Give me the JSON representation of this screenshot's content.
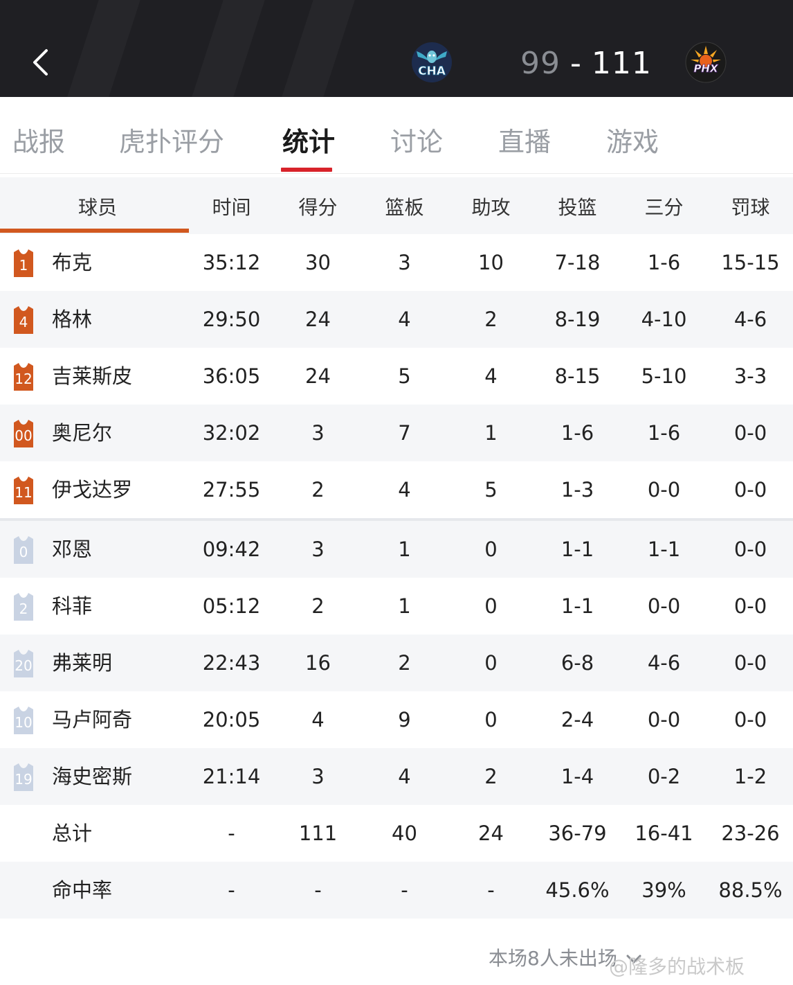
{
  "header": {
    "away_team": "CHA",
    "home_team": "PHX",
    "away_score": "99",
    "score_separator": "-",
    "home_score": "111",
    "back_icon": "chevron-left-icon",
    "colors": {
      "bg": "#1f1f23",
      "away_score": "#8a8d93",
      "home_score": "#ffffff"
    }
  },
  "tabs": [
    {
      "label": "战报"
    },
    {
      "label": "虎扑评分"
    },
    {
      "label": "统计",
      "active": true
    },
    {
      "label": "讨论"
    },
    {
      "label": "直播"
    },
    {
      "label": "游戏"
    }
  ],
  "table": {
    "columns": [
      "球员",
      "时间",
      "得分",
      "篮板",
      "助攻",
      "投篮",
      "三分",
      "罚球"
    ],
    "starters": [
      {
        "number": "1",
        "name": "布克",
        "min": "35:12",
        "pts": "30",
        "reb": "3",
        "ast": "10",
        "fg": "7-18",
        "tp": "1-6",
        "ft": "15-15"
      },
      {
        "number": "4",
        "name": "格林",
        "min": "29:50",
        "pts": "24",
        "reb": "4",
        "ast": "2",
        "fg": "8-19",
        "tp": "4-10",
        "ft": "4-6"
      },
      {
        "number": "12",
        "name": "吉莱斯皮",
        "min": "36:05",
        "pts": "24",
        "reb": "5",
        "ast": "4",
        "fg": "8-15",
        "tp": "5-10",
        "ft": "3-3"
      },
      {
        "number": "00",
        "name": "奥尼尔",
        "min": "32:02",
        "pts": "3",
        "reb": "7",
        "ast": "1",
        "fg": "1-6",
        "tp": "1-6",
        "ft": "0-0"
      },
      {
        "number": "11",
        "name": "伊戈达罗",
        "min": "27:55",
        "pts": "2",
        "reb": "4",
        "ast": "5",
        "fg": "1-3",
        "tp": "0-0",
        "ft": "0-0"
      }
    ],
    "bench": [
      {
        "number": "0",
        "name": "邓恩",
        "min": "09:42",
        "pts": "3",
        "reb": "1",
        "ast": "0",
        "fg": "1-1",
        "tp": "1-1",
        "ft": "0-0"
      },
      {
        "number": "2",
        "name": "科菲",
        "min": "05:12",
        "pts": "2",
        "reb": "1",
        "ast": "0",
        "fg": "1-1",
        "tp": "0-0",
        "ft": "0-0"
      },
      {
        "number": "20",
        "name": "弗莱明",
        "min": "22:43",
        "pts": "16",
        "reb": "2",
        "ast": "0",
        "fg": "6-8",
        "tp": "4-6",
        "ft": "0-0"
      },
      {
        "number": "10",
        "name": "马卢阿奇",
        "min": "20:05",
        "pts": "4",
        "reb": "9",
        "ast": "0",
        "fg": "2-4",
        "tp": "0-0",
        "ft": "0-0"
      },
      {
        "number": "19",
        "name": "海史密斯",
        "min": "21:14",
        "pts": "3",
        "reb": "4",
        "ast": "2",
        "fg": "1-4",
        "tp": "0-2",
        "ft": "1-2"
      }
    ],
    "totals": {
      "name": "总计",
      "min": "-",
      "pts": "111",
      "reb": "40",
      "ast": "24",
      "fg": "36-79",
      "tp": "16-41",
      "ft": "23-26"
    },
    "percentages": {
      "name": "命中率",
      "min": "-",
      "pts": "-",
      "reb": "-",
      "ast": "-",
      "fg": "45.6%",
      "tp": "39%",
      "ft": "88.5%"
    },
    "colors": {
      "starter_jersey": "#d1581f",
      "bench_jersey": "#c9d3e3",
      "accent": "#d8232a"
    }
  },
  "footer": {
    "dnp_note": "本场8人未出场",
    "watermark": "@隆多的战术板"
  }
}
